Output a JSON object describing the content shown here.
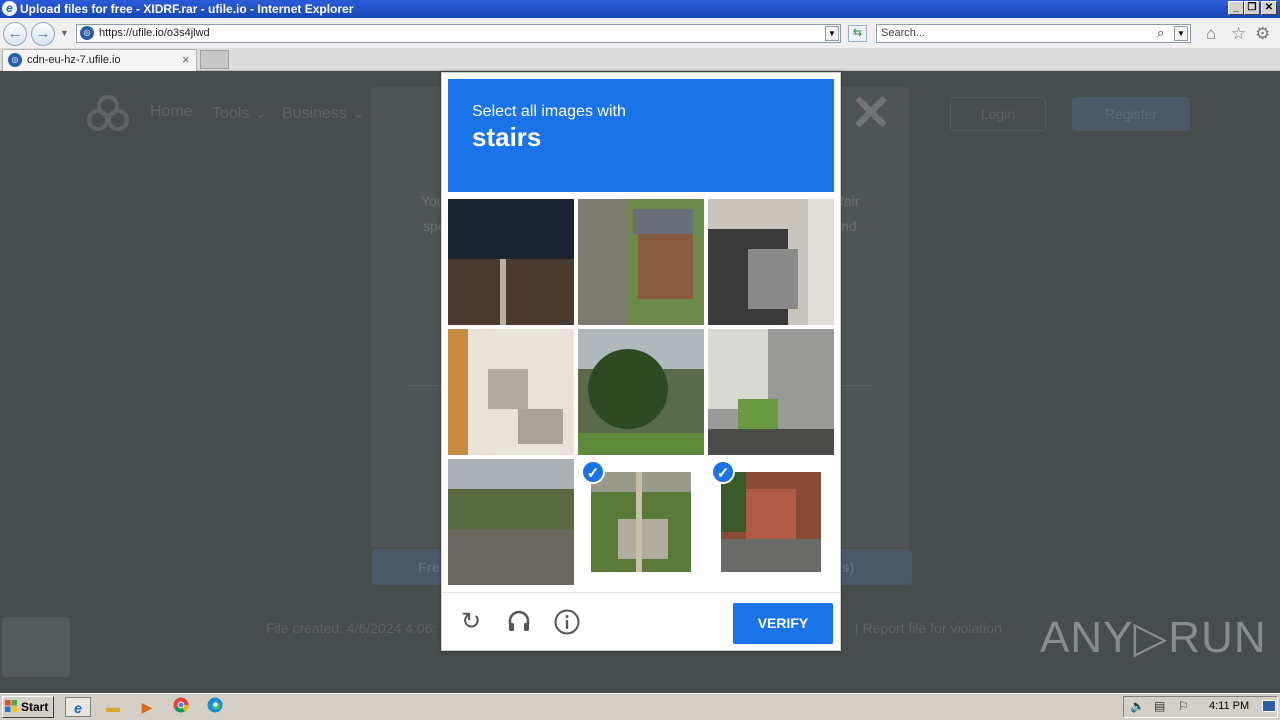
{
  "window": {
    "title": "Upload files for free - XIDRF.rar - ufile.io - Internet Explorer",
    "minimize": "_",
    "restore": "❐",
    "close": "✕"
  },
  "browser": {
    "url": "https://ufile.io/o3s4jlwd",
    "search_placeholder": "Search...",
    "tab_title": "cdn-eu-hz-7.ufile.io",
    "tab_close": "×"
  },
  "page": {
    "nav": [
      "Home",
      "Tools ⌄",
      "Business ⌄"
    ],
    "login": "Login",
    "register": "Register",
    "body_left_1": "You",
    "body_left_2": "spe",
    "body_right_1": "fair",
    "body_right_2": "nd",
    "free_download": "Fre",
    "speed": "/s)",
    "file_created": "File created: 4/6/2024 4:06:",
    "report": "|    Report file for violation"
  },
  "captcha": {
    "instruction": "Select all images with",
    "keyword": "stairs",
    "verify": "VERIFY",
    "tiles": [
      {
        "selected": false
      },
      {
        "selected": false
      },
      {
        "selected": false
      },
      {
        "selected": false
      },
      {
        "selected": false
      },
      {
        "selected": false
      },
      {
        "selected": false
      },
      {
        "selected": true
      },
      {
        "selected": true
      }
    ]
  },
  "watermark": "ANY▷RUN",
  "taskbar": {
    "start": "Start",
    "clock": "4:11 PM"
  }
}
